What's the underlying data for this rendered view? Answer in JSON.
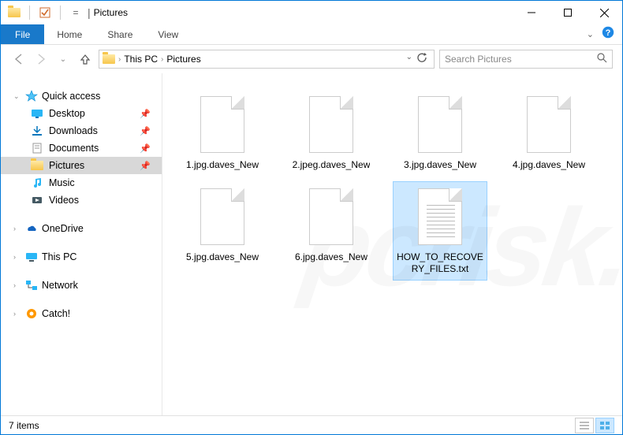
{
  "titlebar": {
    "title": "Pictures"
  },
  "ribbon": {
    "file": "File",
    "tabs": [
      "Home",
      "Share",
      "View"
    ]
  },
  "nav": {
    "breadcrumb": [
      "This PC",
      "Pictures"
    ],
    "search_placeholder": "Search Pictures"
  },
  "sidebar": {
    "quick_access": {
      "label": "Quick access",
      "items": [
        {
          "label": "Desktop",
          "pinned": true
        },
        {
          "label": "Downloads",
          "pinned": true
        },
        {
          "label": "Documents",
          "pinned": true
        },
        {
          "label": "Pictures",
          "pinned": true,
          "selected": true
        },
        {
          "label": "Music",
          "pinned": false
        },
        {
          "label": "Videos",
          "pinned": false
        }
      ]
    },
    "roots": [
      {
        "label": "OneDrive"
      },
      {
        "label": "This PC"
      },
      {
        "label": "Network"
      },
      {
        "label": "Catch!"
      }
    ]
  },
  "files": [
    {
      "name": "1.jpg.daves_New",
      "type": "blank"
    },
    {
      "name": "2.jpeg.daves_New",
      "type": "blank"
    },
    {
      "name": "3.jpg.daves_New",
      "type": "blank"
    },
    {
      "name": "4.jpg.daves_New",
      "type": "blank"
    },
    {
      "name": "5.jpg.daves_New",
      "type": "blank"
    },
    {
      "name": "6.jpg.daves_New",
      "type": "blank"
    },
    {
      "name": "HOW_TO_RECOVERY_FILES.txt",
      "type": "txt",
      "selected": true
    }
  ],
  "status": {
    "count_text": "7 items"
  },
  "watermark": "pcrisk.com"
}
